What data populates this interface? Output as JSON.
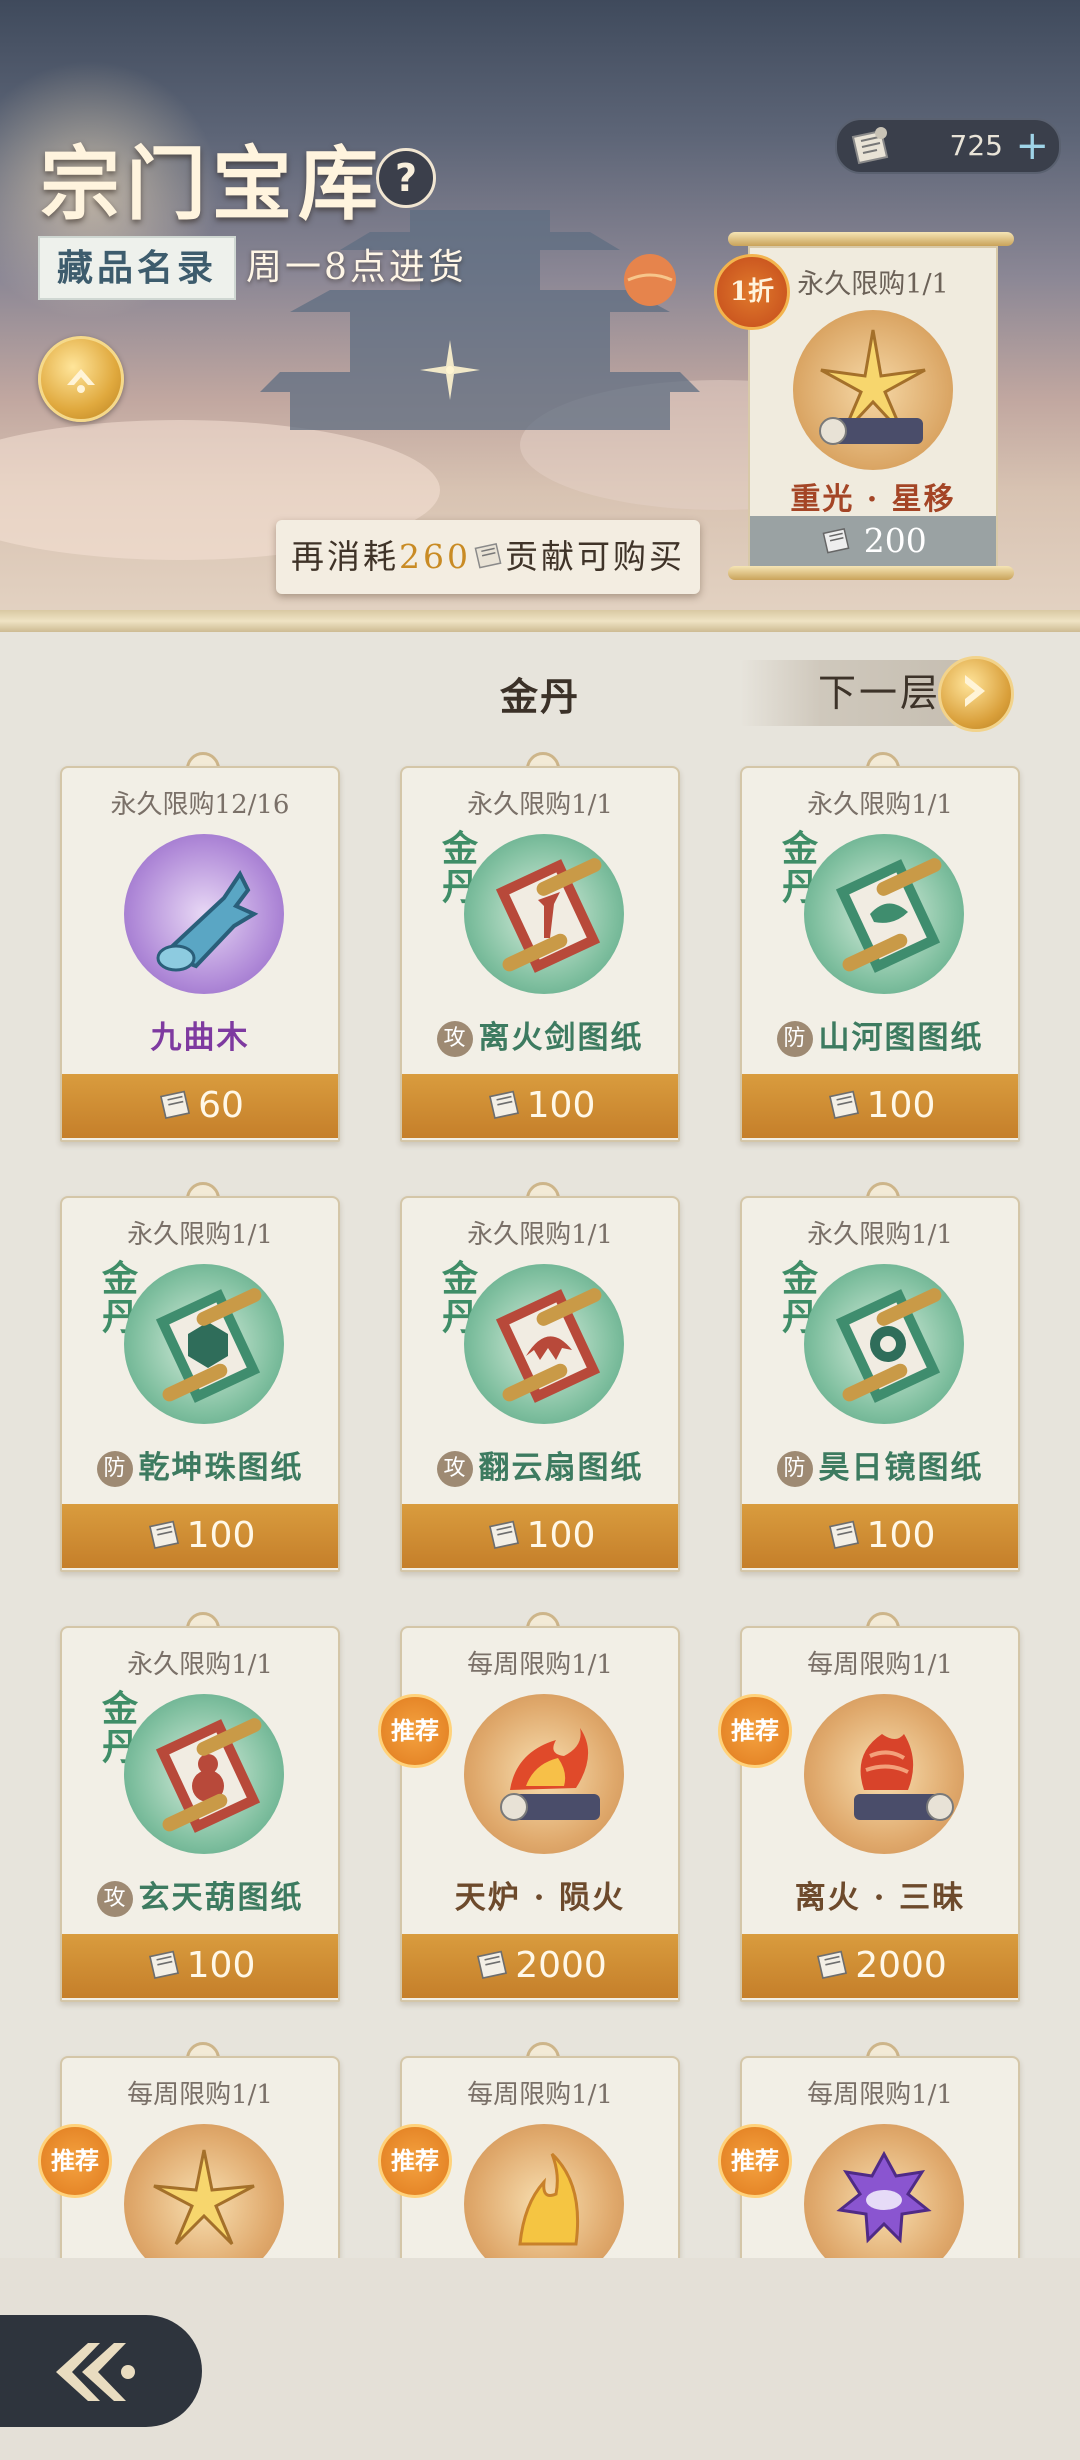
{
  "header": {
    "title": "宗门宝库",
    "help_icon": "?",
    "catalog_label": "藏品名录",
    "restock_text": "周一8点进货",
    "currency_amount": "725",
    "currency_plus": "+",
    "condition_prefix": "再消耗",
    "condition_amount": "260",
    "condition_suffix": "贡献可购买"
  },
  "featured": {
    "limit": "永久限购1/1",
    "discount": "1折",
    "name": "重光 · 星移",
    "price": "200"
  },
  "section": {
    "realm": "金丹",
    "next_label": "下一层"
  },
  "items": [
    {
      "limit": "永久限购12/16",
      "name": "九曲木",
      "price": "60"
    },
    {
      "limit": "永久限购1/1",
      "tag": "攻",
      "name": "离火剑图纸",
      "price": "100",
      "realm_tag": "金丹"
    },
    {
      "limit": "永久限购1/1",
      "tag": "防",
      "name": "山河图图纸",
      "price": "100",
      "realm_tag": "金丹"
    },
    {
      "limit": "永久限购1/1",
      "tag": "防",
      "name": "乾坤珠图纸",
      "price": "100",
      "realm_tag": "金丹"
    },
    {
      "limit": "永久限购1/1",
      "tag": "攻",
      "name": "翻云扇图纸",
      "price": "100",
      "realm_tag": "金丹"
    },
    {
      "limit": "永久限购1/1",
      "tag": "防",
      "name": "昊日镜图纸",
      "price": "100",
      "realm_tag": "金丹"
    },
    {
      "limit": "永久限购1/1",
      "tag": "攻",
      "name": "玄天葫图纸",
      "price": "100",
      "realm_tag": "金丹"
    },
    {
      "limit": "每周限购1/1",
      "recommend": "推荐",
      "name": "天炉 · 陨火",
      "price": "2000"
    },
    {
      "limit": "每周限购1/1",
      "recommend": "推荐",
      "name": "离火 · 三昧",
      "price": "2000"
    },
    {
      "limit": "每周限购1/1",
      "recommend": "推荐"
    },
    {
      "limit": "每周限购1/1",
      "recommend": "推荐"
    },
    {
      "limit": "每周限购1/1",
      "recommend": "推荐"
    }
  ],
  "colors": {
    "accent_gold": "#c98b24",
    "price_bar": "#d1902f",
    "jade": "#4d9d7c"
  }
}
